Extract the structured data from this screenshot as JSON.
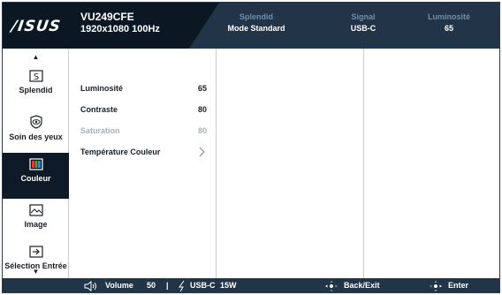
{
  "header": {
    "logo": "/ISUS",
    "model": "VU249CFE",
    "resolution": "1920x1080 100Hz",
    "stats": [
      {
        "title": "Splendid",
        "value": "Mode Standard"
      },
      {
        "title": "Signal",
        "value": "USB-C"
      },
      {
        "title": "Luminosité",
        "value": "65"
      }
    ]
  },
  "sidebar": {
    "items": [
      {
        "label": "Splendid",
        "icon": "splendid-icon"
      },
      {
        "label": "Soin des yeux",
        "icon": "eye-care-icon"
      },
      {
        "label": "Couleur",
        "icon": "color-icon",
        "active": true
      },
      {
        "label": "Image",
        "icon": "image-icon"
      },
      {
        "label": "Sélection Entrée",
        "icon": "input-select-icon"
      }
    ]
  },
  "menu": {
    "items": [
      {
        "label": "Luminosité",
        "value": "65",
        "enabled": true
      },
      {
        "label": "Contraste",
        "value": "80",
        "enabled": true
      },
      {
        "label": "Saturation",
        "value": "80",
        "enabled": false
      },
      {
        "label": "Température Couleur",
        "value": "",
        "enabled": true,
        "submenu": true
      }
    ]
  },
  "footer": {
    "volume_label": "Volume",
    "volume_value": "50",
    "separator": "|",
    "power_label": "USB-C",
    "power_value": "15W",
    "back_label": "Back/Exit",
    "enter_label": "Enter"
  },
  "colors": {
    "header_bg": "#223447",
    "header_dark": "#0c1724",
    "active_bg": "#0e1a28",
    "stat_title": "#6f8fae",
    "disabled_text": "#a9b0b7"
  }
}
